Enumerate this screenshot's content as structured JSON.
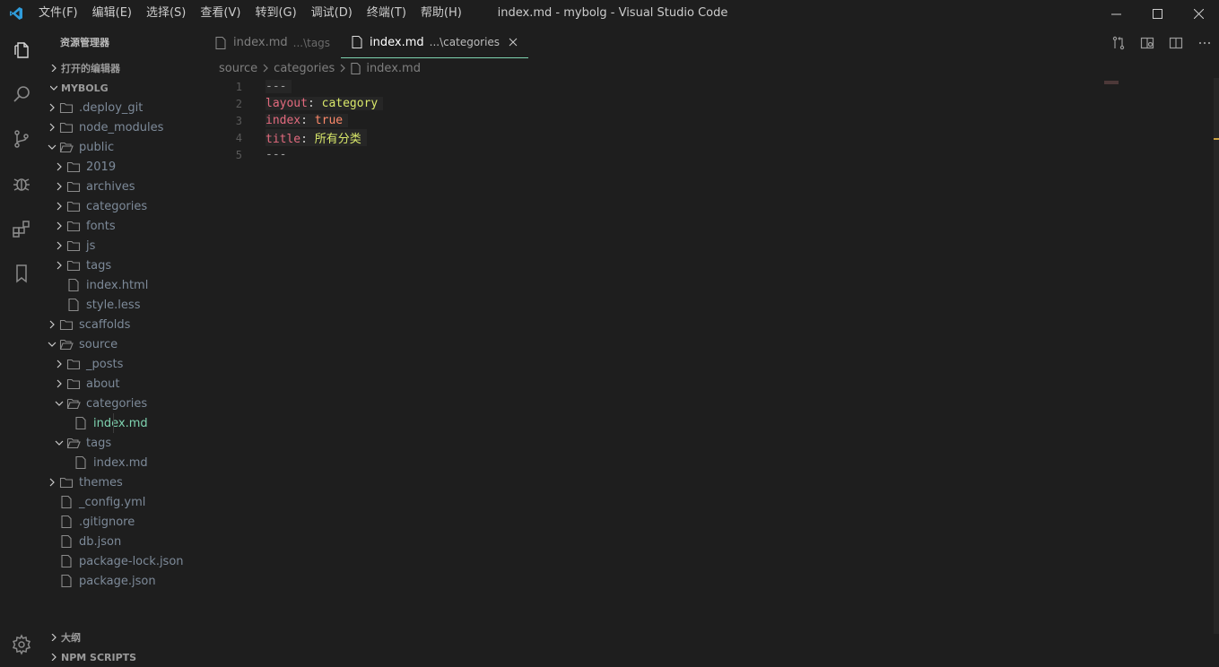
{
  "window": {
    "title": "index.md - mybolg - Visual Studio Code",
    "menu": [
      "文件(F)",
      "编辑(E)",
      "选择(S)",
      "查看(V)",
      "转到(G)",
      "调试(D)",
      "终端(T)",
      "帮助(H)"
    ]
  },
  "sidebar": {
    "title": "资源管理器",
    "open_editors": "打开的编辑器",
    "project": "MYBOLG",
    "tree": [
      {
        "label": ".deploy_git",
        "type": "folder",
        "expanded": false
      },
      {
        "label": "node_modules",
        "type": "folder",
        "expanded": false
      },
      {
        "label": "public",
        "type": "folder",
        "expanded": true
      },
      {
        "label": "2019",
        "type": "folder",
        "expanded": false
      },
      {
        "label": "archives",
        "type": "folder",
        "expanded": false
      },
      {
        "label": "categories",
        "type": "folder",
        "expanded": false
      },
      {
        "label": "fonts",
        "type": "folder",
        "expanded": false
      },
      {
        "label": "js",
        "type": "folder",
        "expanded": false
      },
      {
        "label": "tags",
        "type": "folder",
        "expanded": false
      },
      {
        "label": "index.html",
        "type": "file"
      },
      {
        "label": "style.less",
        "type": "file"
      },
      {
        "label": "scaffolds",
        "type": "folder",
        "expanded": false
      },
      {
        "label": "source",
        "type": "folder",
        "expanded": true
      },
      {
        "label": "_posts",
        "type": "folder",
        "expanded": false
      },
      {
        "label": "about",
        "type": "folder",
        "expanded": false
      },
      {
        "label": "categories",
        "type": "folder",
        "expanded": true
      },
      {
        "label": "index.md",
        "type": "file",
        "active": true
      },
      {
        "label": "tags",
        "type": "folder",
        "expanded": true
      },
      {
        "label": "index.md",
        "type": "file"
      },
      {
        "label": "themes",
        "type": "folder",
        "expanded": false
      },
      {
        "label": "_config.yml",
        "type": "file"
      },
      {
        "label": ".gitignore",
        "type": "file"
      },
      {
        "label": "db.json",
        "type": "file"
      },
      {
        "label": "package-lock.json",
        "type": "file"
      },
      {
        "label": "package.json",
        "type": "file"
      }
    ],
    "outline": "大纲",
    "npm_scripts": "NPM SCRIPTS"
  },
  "tabs": [
    {
      "name": "index.md",
      "desc": "...\\tags",
      "active": false
    },
    {
      "name": "index.md",
      "desc": "...\\categories",
      "active": true
    }
  ],
  "breadcrumb": [
    "source",
    "categories",
    "index.md"
  ],
  "code": {
    "line_numbers": [
      "1",
      "2",
      "3",
      "4",
      "5"
    ],
    "line1": "---",
    "line2_key": "layout",
    "line2_value": "category",
    "line3_key": "index",
    "line3_value": "true",
    "line4_key": "title",
    "line4_value": "所有分类",
    "line5": "---",
    "colon": ": "
  },
  "colors": {
    "accent": "#7fd3b0",
    "background": "#1e1e1e",
    "vscode_blue": "#2f9cdb"
  }
}
